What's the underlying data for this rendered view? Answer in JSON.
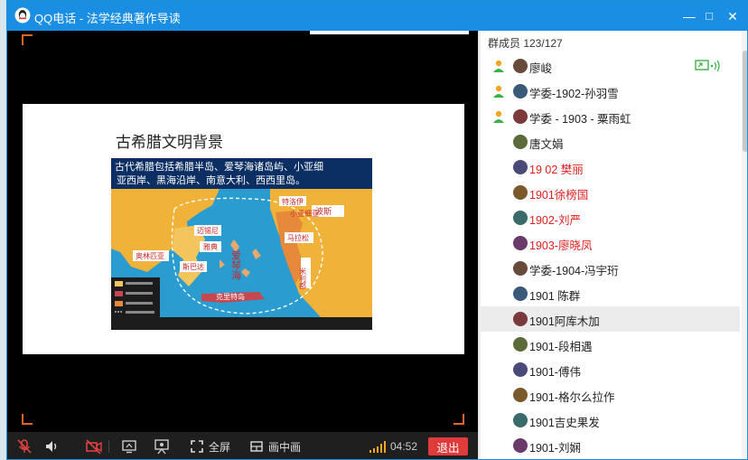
{
  "window": {
    "title": "QQ电话 - 法学经典著作导读",
    "controls": {
      "minimize": "—",
      "maximize": "□",
      "close": "✕"
    }
  },
  "slide": {
    "title": "古希腊文明背景",
    "banner_line1": "古代希腊包括希腊半岛、爱琴海诸岛屿、小亚细",
    "banner_line2": "亚西岸、黑海沿岸、南意大利、西西里岛。",
    "labels": {
      "aegean": "爱琴海",
      "asia_minor": "小亚细亚",
      "crete": "克里特岛",
      "trojan": "特洛伊",
      "persia": "波斯",
      "miletus": "米利都",
      "athens": "雅典",
      "sparta": "斯巴达",
      "mycenae": "迈锡尼",
      "olympia": "奥林匹亚",
      "thebes": "马拉松"
    }
  },
  "toolbar": {
    "timer": "04:52",
    "fullscreen_label": "全屏",
    "pip_label": "画中画",
    "exit_label": "退出"
  },
  "members": {
    "count_label": "群成员 123/127",
    "list": [
      {
        "name": "廖峻",
        "color": "#222222",
        "speaking": true,
        "screen": true
      },
      {
        "name": "学委-1902-孙羽雪",
        "color": "#222222",
        "speaking": true,
        "screen": false
      },
      {
        "name": "学委 - 1903 - 粟雨虹",
        "color": "#222222",
        "speaking": true,
        "screen": false
      },
      {
        "name": "唐文娟",
        "color": "#222222",
        "speaking": false,
        "screen": false
      },
      {
        "name": "19 02 樊丽",
        "color": "#e02020",
        "speaking": false,
        "screen": false
      },
      {
        "name": "1901徐榜国",
        "color": "#e02020",
        "speaking": false,
        "screen": false
      },
      {
        "name": "1902-刘严",
        "color": "#e02020",
        "speaking": false,
        "screen": false
      },
      {
        "name": "1903-廖晓凤",
        "color": "#e02020",
        "speaking": false,
        "screen": false
      },
      {
        "name": "学委-1904-冯宇珩",
        "color": "#222222",
        "speaking": false,
        "screen": false
      },
      {
        "name": "1901 陈群",
        "color": "#222222",
        "speaking": false,
        "screen": false
      },
      {
        "name": "1901阿库木加",
        "color": "#222222",
        "speaking": false,
        "screen": false,
        "selected": true
      },
      {
        "name": "1901-段相遇",
        "color": "#222222",
        "speaking": false,
        "screen": false
      },
      {
        "name": "1901-傅伟",
        "color": "#222222",
        "speaking": false,
        "screen": false
      },
      {
        "name": "1901-格尔么拉作",
        "color": "#222222",
        "speaking": false,
        "screen": false
      },
      {
        "name": "1901吉史果发",
        "color": "#222222",
        "speaking": false,
        "screen": false
      },
      {
        "name": "1901-刘娴",
        "color": "#222222",
        "speaking": false,
        "screen": false
      }
    ]
  },
  "colors": {
    "titlebar": "#1a8ee2",
    "exit_button": "#e03a3a",
    "accent_orange": "#e4632a",
    "muted_red": "#e04040",
    "speaking_green": "#3bb34a"
  },
  "icons": [
    "qq-logo-icon",
    "mic-muted-icon",
    "speaker-icon",
    "camera-off-icon",
    "screen-share-icon",
    "whiteboard-icon",
    "fullscreen-icon",
    "pip-icon",
    "signal-icon",
    "person-icon",
    "screen-sharing-icon",
    "audio-wave-icon"
  ]
}
